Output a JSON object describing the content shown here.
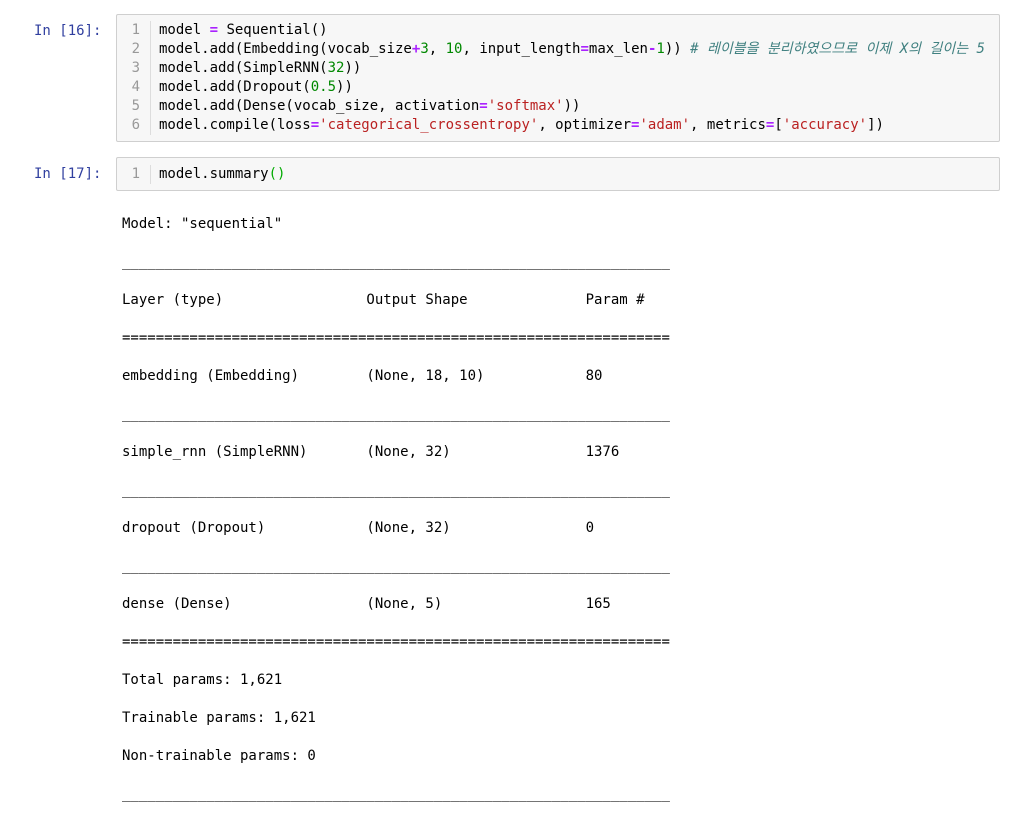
{
  "cells": [
    {
      "prompt": "In [16]:",
      "lines": [
        {
          "num": "1",
          "parts": [
            {
              "t": "model ",
              "c": ""
            },
            {
              "t": "=",
              "c": "kw-op"
            },
            {
              "t": " Sequential()",
              "c": ""
            }
          ]
        },
        {
          "num": "2",
          "parts": [
            {
              "t": "model.add(Embedding(vocab_size",
              "c": ""
            },
            {
              "t": "+",
              "c": "kw-op"
            },
            {
              "t": "3",
              "c": "num"
            },
            {
              "t": ", ",
              "c": ""
            },
            {
              "t": "10",
              "c": "num"
            },
            {
              "t": ", input_length",
              "c": ""
            },
            {
              "t": "=",
              "c": "kw-op"
            },
            {
              "t": "max_len",
              "c": ""
            },
            {
              "t": "-",
              "c": "kw-op"
            },
            {
              "t": "1",
              "c": "num"
            },
            {
              "t": ")) ",
              "c": ""
            },
            {
              "t": "# 레이블을 분리하였으므로 이제 X의 길이는 5",
              "c": "cmt"
            }
          ]
        },
        {
          "num": "3",
          "parts": [
            {
              "t": "model.add(SimpleRNN(",
              "c": ""
            },
            {
              "t": "32",
              "c": "num"
            },
            {
              "t": "))",
              "c": ""
            }
          ]
        },
        {
          "num": "4",
          "parts": [
            {
              "t": "model.add(Dropout(",
              "c": ""
            },
            {
              "t": "0.5",
              "c": "num"
            },
            {
              "t": "))",
              "c": ""
            }
          ]
        },
        {
          "num": "5",
          "parts": [
            {
              "t": "model.add(Dense(vocab_size, activation",
              "c": ""
            },
            {
              "t": "=",
              "c": "kw-op"
            },
            {
              "t": "'softmax'",
              "c": "str"
            },
            {
              "t": "))",
              "c": ""
            }
          ]
        },
        {
          "num": "6",
          "parts": [
            {
              "t": "model.compile(loss",
              "c": ""
            },
            {
              "t": "=",
              "c": "kw-op"
            },
            {
              "t": "'categorical_crossentropy'",
              "c": "str"
            },
            {
              "t": ", optimizer",
              "c": ""
            },
            {
              "t": "=",
              "c": "kw-op"
            },
            {
              "t": "'adam'",
              "c": "str"
            },
            {
              "t": ", metrics",
              "c": ""
            },
            {
              "t": "=",
              "c": "kw-op"
            },
            {
              "t": "[",
              "c": ""
            },
            {
              "t": "'accuracy'",
              "c": "str"
            },
            {
              "t": "])",
              "c": ""
            }
          ]
        }
      ]
    },
    {
      "prompt": "In [17]:",
      "lines": [
        {
          "num": "1",
          "parts": [
            {
              "t": "model.summary",
              "c": ""
            },
            {
              "t": "()",
              "c": "paren-g"
            }
          ]
        }
      ]
    }
  ],
  "output": {
    "model_line": "Model: \"sequential\"",
    "rule_thin": "_________________________________________________________________",
    "rule_thick": "=================================================================",
    "header": "Layer (type)                 Output Shape              Param #   ",
    "rows": [
      "embedding (Embedding)        (None, 18, 10)            80        ",
      "simple_rnn (SimpleRNN)       (None, 32)                1376      ",
      "dropout (Dropout)            (None, 32)                0         ",
      "dense (Dense)                (None, 5)                 165       "
    ],
    "total": "Total params: 1,621",
    "trainable": "Trainable params: 1,621",
    "non_trainable": "Non-trainable params: 0"
  }
}
